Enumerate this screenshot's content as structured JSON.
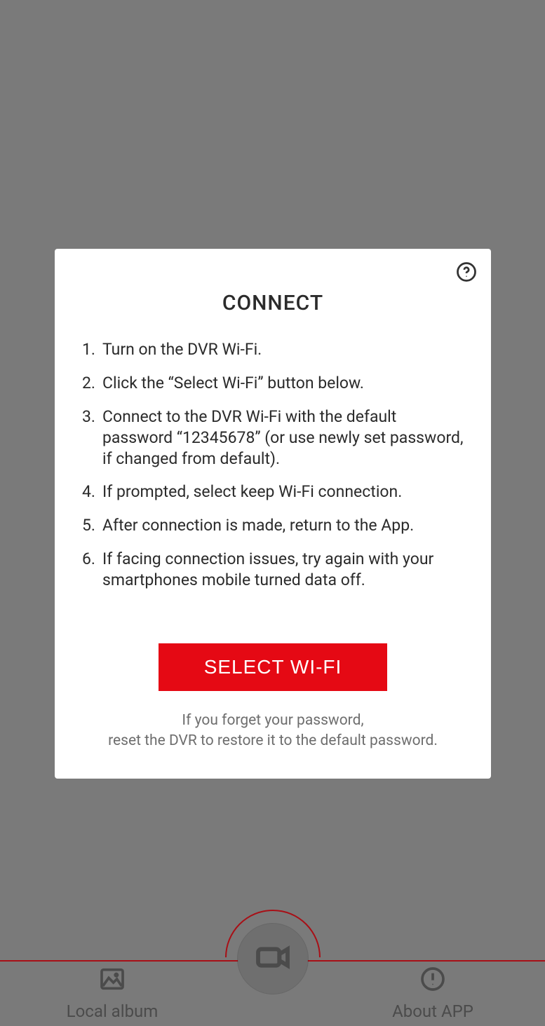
{
  "modal": {
    "title": "CONNECT",
    "steps": [
      "Turn on the DVR Wi-Fi.",
      "Click the “Select Wi-Fi” button below.",
      "Connect to the DVR Wi-Fi with the default password “12345678” (or use newly set password, if changed from default).",
      "If prompted, select keep Wi-Fi connection.",
      "After connection is made, return to the App.",
      "If facing connection issues, try again with your smartphones mobile turned data off."
    ],
    "button_label": "SELECT WI-FI",
    "footer_line1": "If you forget your password,",
    "footer_line2": "reset the DVR to restore it to the default password."
  },
  "nav": {
    "local_album": "Local album",
    "about_app": "About APP"
  }
}
